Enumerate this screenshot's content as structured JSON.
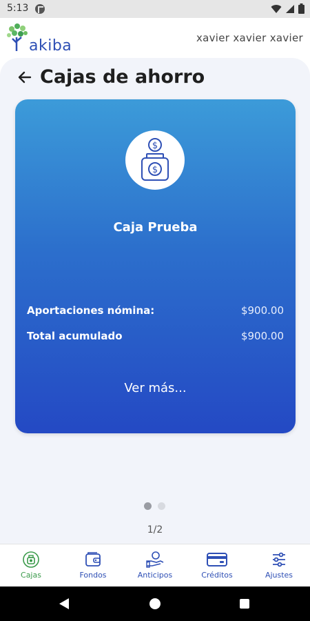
{
  "status_bar": {
    "time": "5:13"
  },
  "header": {
    "logo_text": "akiba",
    "user_name": "xavier  xavier xavier"
  },
  "page": {
    "title": "Cajas de ahorro"
  },
  "card": {
    "title": "Caja Prueba",
    "rows": [
      {
        "label": "Aportaciones nómina:",
        "value": "$900.00"
      },
      {
        "label": "Total acumulado",
        "value": "$900.00"
      }
    ],
    "more_link": "Ver más..."
  },
  "pagination": {
    "text": "1/2",
    "current": 1,
    "total": 2
  },
  "bottom_nav": {
    "items": [
      {
        "label": "Cajas",
        "icon": "savings-jar-icon",
        "active": true
      },
      {
        "label": "Fondos",
        "icon": "wallet-icon",
        "active": false
      },
      {
        "label": "Anticipos",
        "icon": "hand-coin-icon",
        "active": false
      },
      {
        "label": "Créditos",
        "icon": "credit-card-icon",
        "active": false
      },
      {
        "label": "Ajustes",
        "icon": "sliders-icon",
        "active": false
      }
    ]
  },
  "colors": {
    "accent": "#2e4fb5",
    "active_nav": "#3a9a4a",
    "card_top": "#3c9bd9",
    "card_bottom": "#2449c4"
  }
}
